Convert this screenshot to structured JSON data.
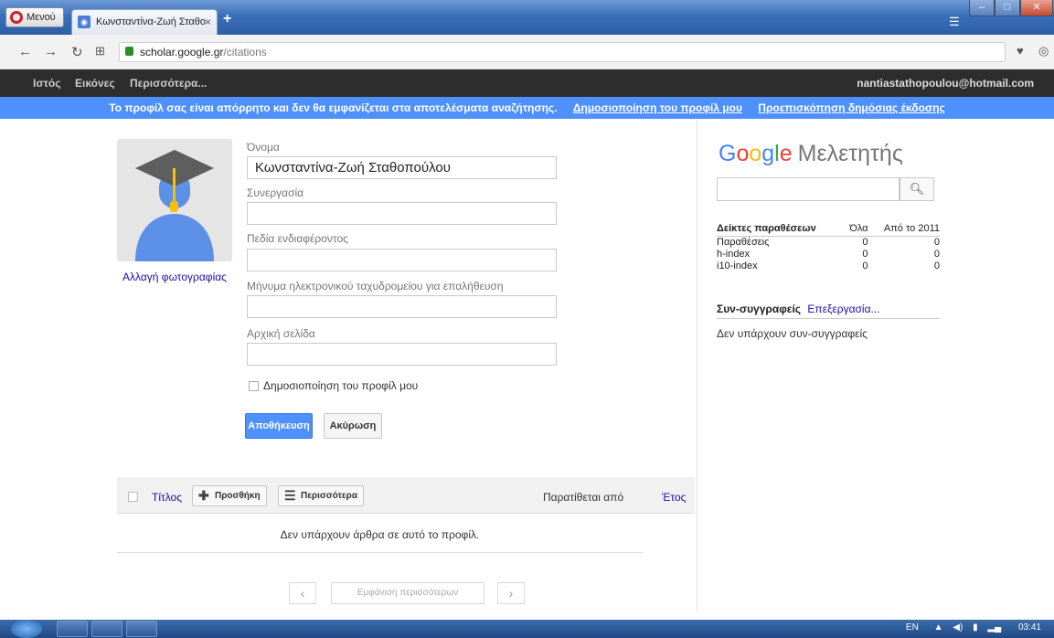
{
  "browser": {
    "menu_label": "Μενού",
    "tab_title": "Κωνσταντίνα-Ζωή Σταθο",
    "tab_close": "×",
    "new_tab": "+",
    "url_host": "scholar.google.gr",
    "url_path": "/citations"
  },
  "gbar": {
    "items": [
      "Ιστός",
      "Εικόνες",
      "Περισσότερα..."
    ],
    "user_email": "nantiastathopoulou@hotmail.com"
  },
  "notice": {
    "text": "Το προφίλ σας είναι απόρρητο και δεν θα εμφανίζεται στα αποτελέσματα αναζήτησης.",
    "link_publish": "Δημοσιοποίηση του προφίλ μου",
    "link_preview": "Προεπισκόπηση δημόσιας έκδοσης"
  },
  "profile": {
    "change_photo": "Αλλαγή φωτογραφίας",
    "name_label": "Όνομα",
    "name_value": "Κωνσταντίνα-Ζωή Σταθοπούλου",
    "affiliation_label": "Συνεργασία",
    "affiliation_value": "",
    "interests_label": "Πεδία ενδιαφέροντος",
    "interests_value": "",
    "email_label": "Μήνυμα ηλεκτρονικού ταχυδρομείου για επαλήθευση",
    "email_value": "",
    "homepage_label": "Αρχική σελίδα",
    "homepage_value": "",
    "public_label": "Δημοσιοποίηση του προφίλ μου",
    "save": "Αποθήκευση",
    "cancel": "Ακύρωση"
  },
  "articles": {
    "title_col": "Τίτλος",
    "add_btn": "Προσθήκη",
    "more_btn": "Περισσότερα",
    "cited_by": "Παρατίθεται από",
    "year": "Έτος",
    "empty": "Δεν υπάρχουν άρθρα σε αυτό το προφίλ.",
    "show_more": "Εμφάνιση περισσότερων",
    "prev": "‹",
    "next": "›"
  },
  "sidebar": {
    "logo_google": [
      "G",
      "o",
      "o",
      "g",
      "l",
      "e"
    ],
    "logo_name": "Μελετητής",
    "citations_header": "Δείκτες παραθέσεων",
    "col_all": "Όλα",
    "col_since": "Από το 2011",
    "rows": [
      {
        "label": "Παραθέσεις",
        "all": "0",
        "since": "0"
      },
      {
        "label": "h-index",
        "all": "0",
        "since": "0"
      },
      {
        "label": "i10-index",
        "all": "0",
        "since": "0"
      }
    ],
    "coauthors_title": "Συν-συγγραφείς",
    "coauthors_edit": "Επεξεργασία...",
    "no_coauthors": "Δεν υπάρχουν συν-συγγραφείς"
  },
  "taskbar": {
    "lang": "EN",
    "time": "03:41"
  }
}
